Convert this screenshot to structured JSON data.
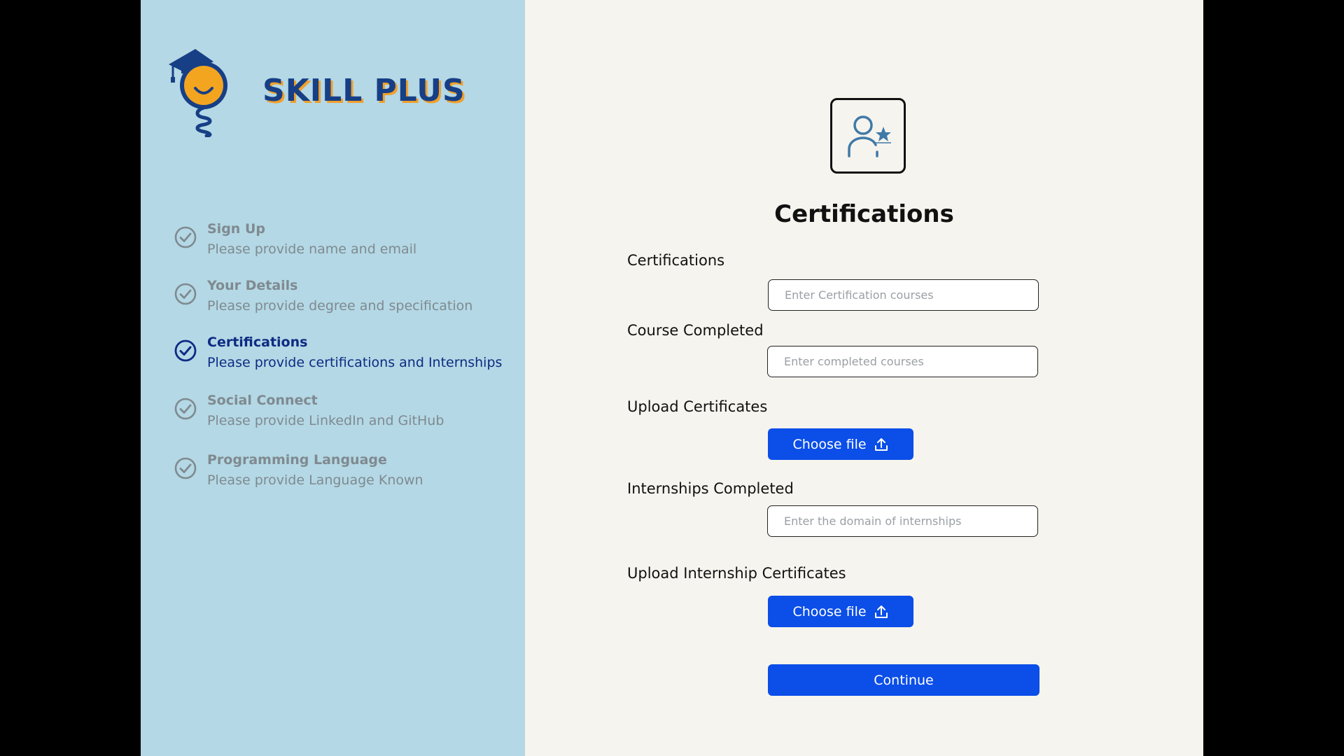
{
  "brand": {
    "name": "SKILL PLUS",
    "logo_icon": "graduation-lightbulb-icon",
    "colors": {
      "primary": "#173f86",
      "accent": "#f0a02b"
    }
  },
  "steps": [
    {
      "title": "Sign Up",
      "description": "Please provide name and email",
      "state": "completed",
      "icon": "check-circle-icon"
    },
    {
      "title": "Your Details",
      "description": "Please provide degree and specification",
      "state": "completed",
      "icon": "check-circle-icon"
    },
    {
      "title": "Certifications",
      "description": "Please provide certifications and Internships",
      "state": "active",
      "icon": "check-circle-icon"
    },
    {
      "title": "Social Connect",
      "description": "Please provide LinkedIn and GitHub",
      "state": "pending",
      "icon": "check-circle-icon"
    },
    {
      "title": "Programming Language",
      "description": "Please provide Language Known",
      "state": "pending",
      "icon": "check-circle-icon"
    }
  ],
  "main": {
    "header_icon": "user-star-icon",
    "title": "Certifications",
    "fields": {
      "certifications": {
        "label": "Certifications",
        "placeholder": "Enter Certification courses",
        "value": ""
      },
      "course_completed": {
        "label": "Course Completed",
        "placeholder": "Enter completed courses",
        "value": ""
      },
      "upload_certificates": {
        "label": "Upload Certificates",
        "button": "Choose file",
        "icon": "upload-icon"
      },
      "internships_completed": {
        "label": "Internships Completed",
        "placeholder": "Enter the domain of internships",
        "value": ""
      },
      "upload_internship_certificates": {
        "label": "Upload Internship Certificates",
        "button": "Choose file",
        "icon": "upload-icon"
      }
    },
    "continue_label": "Continue"
  },
  "colors": {
    "sidebar_bg": "#b4d8e5",
    "main_bg": "#f6f4ee",
    "button_blue": "#0b4ee8",
    "active_step": "#0d2b83",
    "inactive_step": "#7f8a90"
  }
}
